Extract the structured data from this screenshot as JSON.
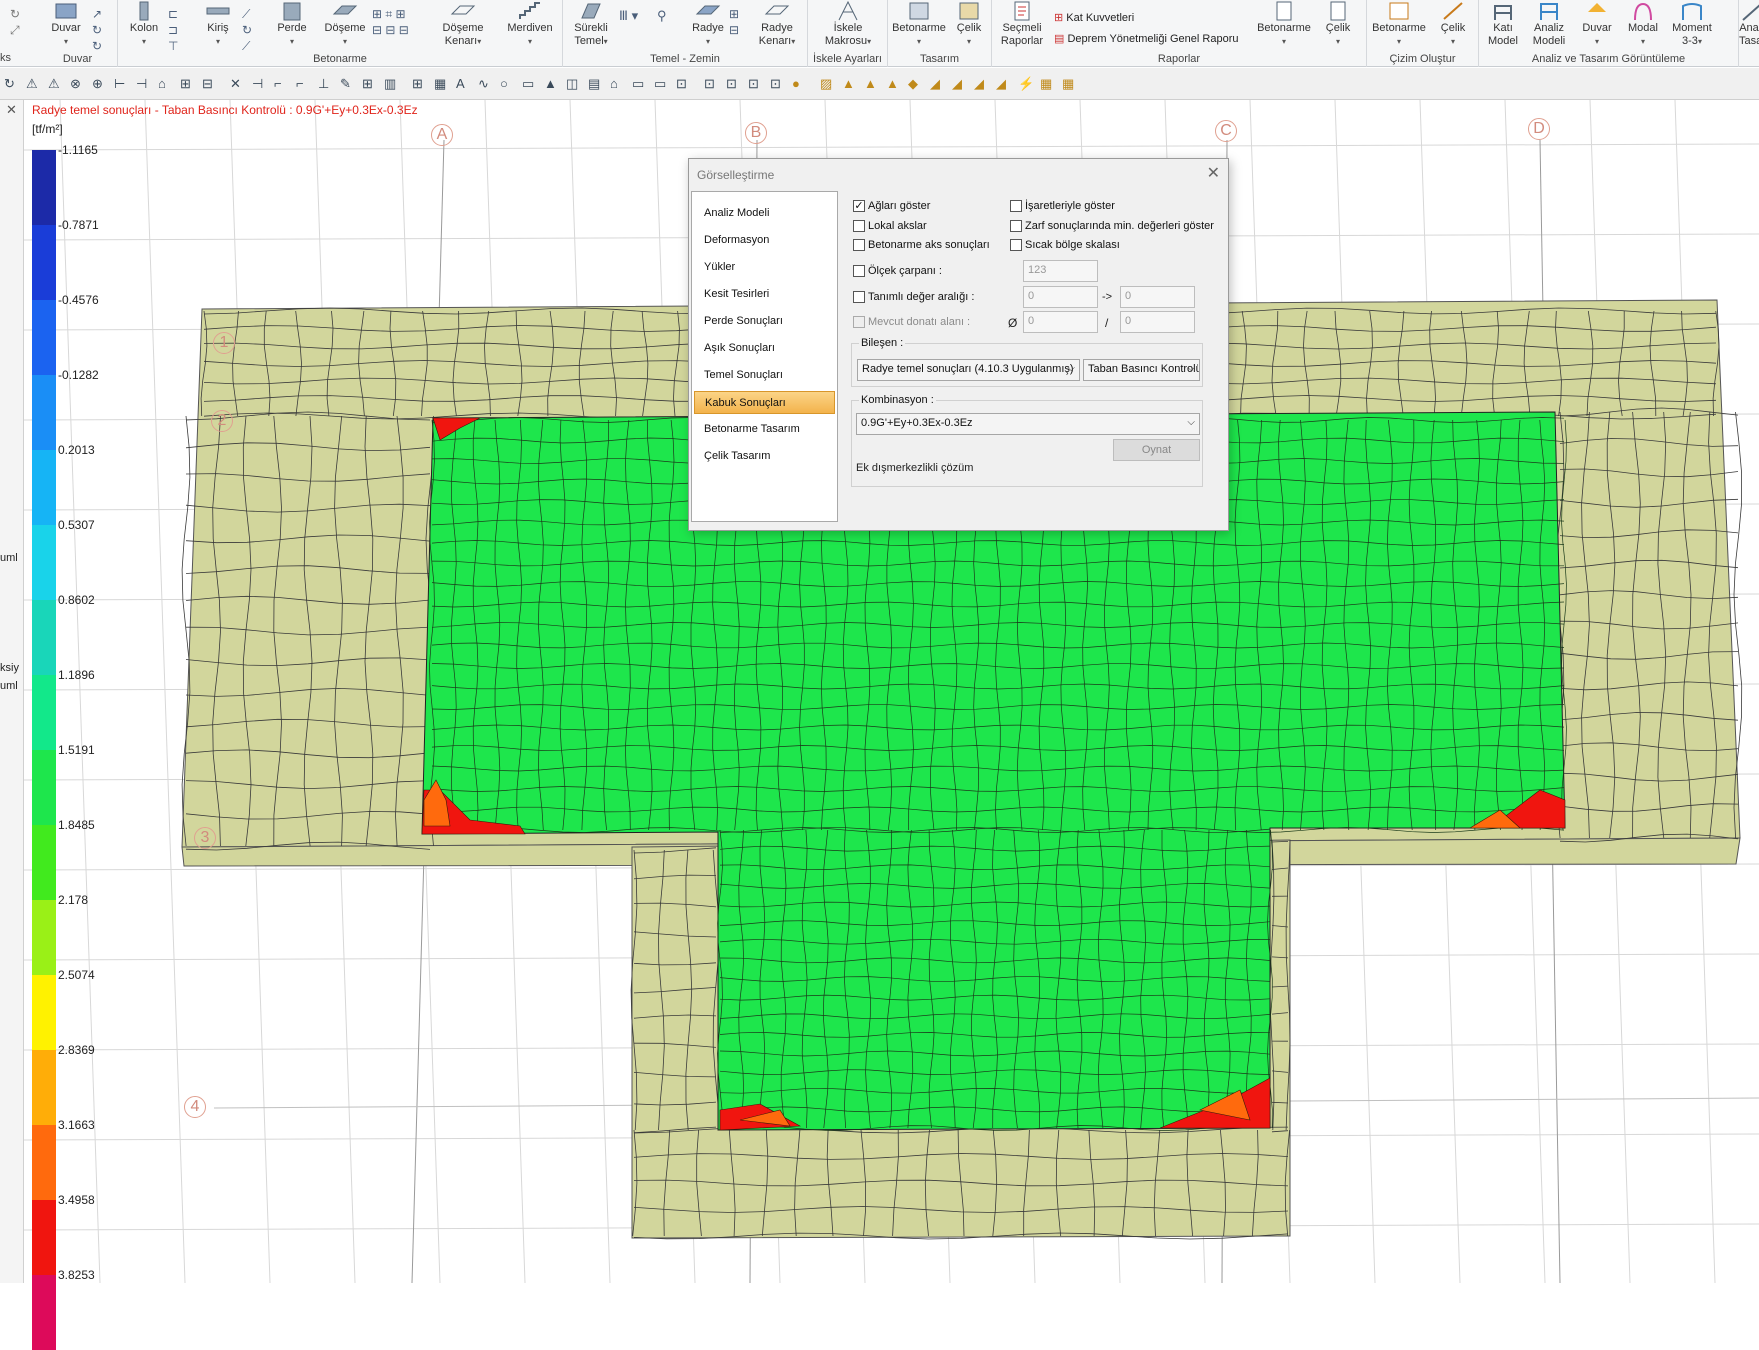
{
  "ribbon": {
    "groups": [
      {
        "label": "Duvar"
      },
      {
        "label": "Betonarme"
      },
      {
        "label": "Temel - Zemin"
      },
      {
        "label": "İskele Ayarları"
      },
      {
        "label": "Tasarım"
      },
      {
        "label": "Raporlar"
      },
      {
        "label": "Çizim Oluştur"
      },
      {
        "label": "Analiz ve Tasarım Görüntüleme"
      }
    ],
    "left_label": "ks",
    "buttons": [
      {
        "label1": "Duvar",
        "label2": ""
      },
      {
        "label1": "Kolon",
        "label2": ""
      },
      {
        "label1": "Kiriş",
        "label2": ""
      },
      {
        "label1": "Perde",
        "label2": ""
      },
      {
        "label1": "Döşeme",
        "label2": ""
      },
      {
        "label1": "Döşeme",
        "label2": "Kenarı"
      },
      {
        "label1": "Merdiven",
        "label2": ""
      },
      {
        "label1": "Sürekli",
        "label2": "Temel"
      },
      {
        "label1": "Radye",
        "label2": ""
      },
      {
        "label1": "Radye",
        "label2": "Kenarı"
      },
      {
        "label1": "İskele",
        "label2": "Makrosu"
      },
      {
        "label1": "Betonarme",
        "label2": ""
      },
      {
        "label1": "Çelik",
        "label2": ""
      },
      {
        "label1": "Seçmeli",
        "label2": "Raporlar"
      },
      {
        "label1": "Betonarme",
        "label2": ""
      },
      {
        "label1": "Çelik",
        "label2": ""
      },
      {
        "label1": "Betonarme",
        "label2": ""
      },
      {
        "label1": "Çelik",
        "label2": ""
      },
      {
        "label1": "Katı",
        "label2": "Model"
      },
      {
        "label1": "Analiz",
        "label2": "Modeli"
      },
      {
        "label1": "Duvar",
        "label2": ""
      },
      {
        "label1": "Modal",
        "label2": ""
      },
      {
        "label1": "Moment",
        "label2": "3-3"
      },
      {
        "label1": "Ana",
        "label2": "Tasar"
      }
    ],
    "report_links": [
      "Kat Kuvvetleri",
      "Deprem Yönetmeliği Genel Raporu"
    ]
  },
  "view": {
    "title": "Radye temel sonuçları - Taban Basıncı Kontrolü : 0.9G'+Ey+0.3Ex-0.3Ez",
    "units": "[tf/m²]",
    "legend_values": [
      "-1.1165",
      "-0.7871",
      "-0.4576",
      "-0.1282",
      "0.2013",
      "0.5307",
      "0.8602",
      "1.1896",
      "1.5191",
      "1.8485",
      "2.178",
      "2.5074",
      "2.8369",
      "3.1663",
      "3.4958",
      "3.8253"
    ],
    "legend_colors": [
      "#1c2aa8",
      "#1a3dd8",
      "#1b63f0",
      "#1a8ef6",
      "#16b4f5",
      "#19d3ea",
      "#19d6b9",
      "#12e88a",
      "#1ee64c",
      "#41ea1e",
      "#9af017",
      "#fff200",
      "#ffad08",
      "#ff6a0d",
      "#f0150f",
      "#dd0a5a"
    ],
    "axis_labels": [
      "A",
      "B",
      "C",
      "D",
      "1",
      "2",
      "3",
      "4"
    ],
    "side_fragments": [
      "uml",
      "ksiy",
      "uml"
    ]
  },
  "dialog": {
    "title": "Görselleştirme",
    "nav": [
      "Analiz Modeli",
      "Deformasyon",
      "Yükler",
      "Kesit Tesirleri",
      "Perde Sonuçları",
      "Aşık Sonuçları",
      "Temel Sonuçları",
      "Kabuk Sonuçları",
      "Betonarme Tasarım",
      "Çelik Tasarım"
    ],
    "active_nav": "Kabuk Sonuçları",
    "checks": {
      "aglari_goster": {
        "label": "Ağları göster",
        "checked": true
      },
      "lokal_akslar": {
        "label": "Lokal akslar",
        "checked": false
      },
      "betonarme_aks": {
        "label": "Betonarme aks sonuçları",
        "checked": false
      },
      "olcek_carpani": {
        "label": "Ölçek çarpanı :",
        "checked": false
      },
      "tanimli_deger": {
        "label": "Tanımlı değer aralığı :",
        "checked": false
      },
      "mevcut_donati": {
        "label": "Mevcut donatı alanı :",
        "checked": false
      },
      "isaretleriyle": {
        "label": "İşaretleriyle göster",
        "checked": false
      },
      "zarf_min": {
        "label": "Zarf sonuçlarında min. değerleri göster",
        "checked": false
      },
      "sicak_bolge": {
        "label": "Sıcak bölge skalası",
        "checked": false
      }
    },
    "olcek_value": "123",
    "range_from": "0",
    "range_arrow": "->",
    "range_to": "0",
    "diameter_symbol": "Ø",
    "donati_a": "0",
    "donati_sep": "/",
    "donati_b": "0",
    "bilesen_label": "Bileşen :",
    "bilesen_select1": "Radye temel sonuçları (4.10.3 Uygulanmış)",
    "bilesen_select2": "Taban Basıncı Kontrolü",
    "kombinasyon_label": "Kombinasyon :",
    "kombinasyon_select": "0.9G'+Ey+0.3Ex-0.3Ez",
    "play_button": "Oynat",
    "ek_text": "Ek dışmerkezlikli çözüm"
  }
}
